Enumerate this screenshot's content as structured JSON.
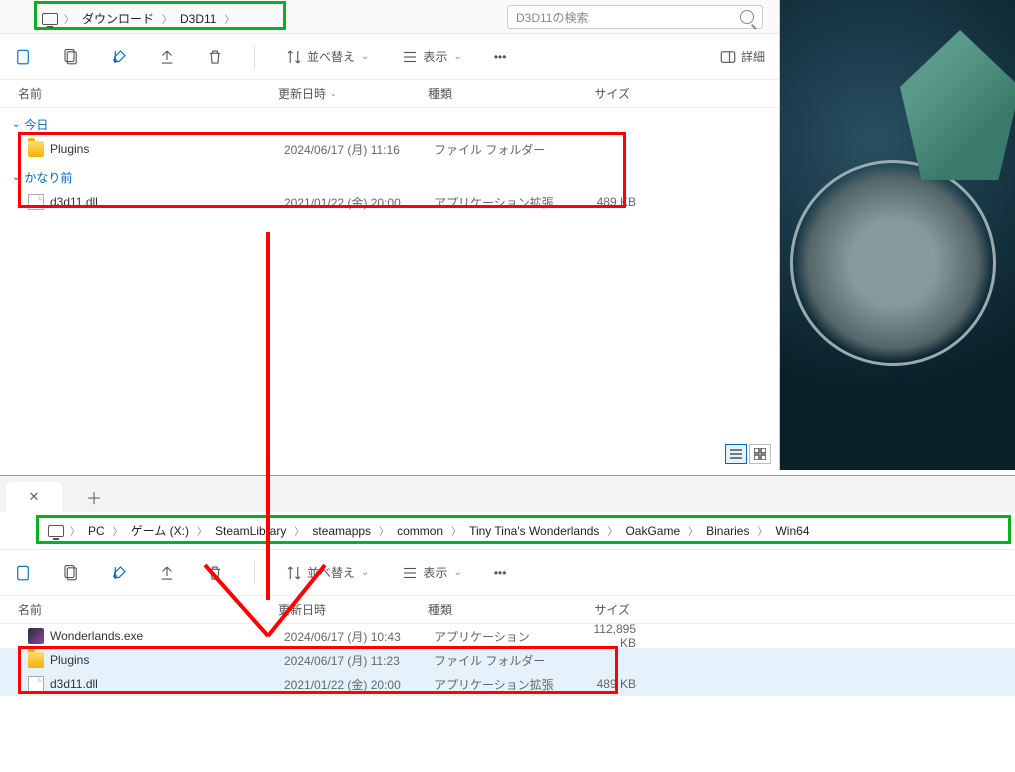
{
  "top": {
    "breadcrumbs": [
      "ダウンロード",
      "D3D11"
    ],
    "search_placeholder": "D3D11の検索",
    "toolbar": {
      "sort": "並べ替え",
      "view": "表示",
      "details": "詳細"
    },
    "cols": {
      "name": "名前",
      "date": "更新日時",
      "type": "種類",
      "size": "サイズ"
    },
    "groups": [
      {
        "label": "今日",
        "rows": [
          {
            "icon": "folder",
            "name": "Plugins",
            "date": "2024/06/17 (月) 11:16",
            "type": "ファイル フォルダー",
            "size": ""
          }
        ]
      },
      {
        "label": "かなり前",
        "rows": [
          {
            "icon": "file",
            "name": "d3d11.dll",
            "date": "2021/01/22 (金) 20:00",
            "type": "アプリケーション拡張",
            "size": "489 KB"
          }
        ]
      }
    ]
  },
  "bottom": {
    "breadcrumbs": [
      "PC",
      "ゲーム (X:)",
      "SteamLibrary",
      "steamapps",
      "common",
      "Tiny Tina's Wonderlands",
      "OakGame",
      "Binaries",
      "Win64"
    ],
    "toolbar": {
      "sort": "並べ替え",
      "view": "表示"
    },
    "cols": {
      "name": "名前",
      "date": "更新日時",
      "type": "種類",
      "size": "サイズ"
    },
    "rows": [
      {
        "icon": "exe",
        "name": "Wonderlands.exe",
        "date": "2024/06/17 (月) 10:43",
        "type": "アプリケーション",
        "size": "112,895 KB",
        "sel": false
      },
      {
        "icon": "folder",
        "name": "Plugins",
        "date": "2024/06/17 (月) 11:23",
        "type": "ファイル フォルダー",
        "size": "",
        "sel": true
      },
      {
        "icon": "file",
        "name": "d3d11.dll",
        "date": "2021/01/22 (金) 20:00",
        "type": "アプリケーション拡張",
        "size": "489 KB",
        "sel": true
      }
    ]
  }
}
